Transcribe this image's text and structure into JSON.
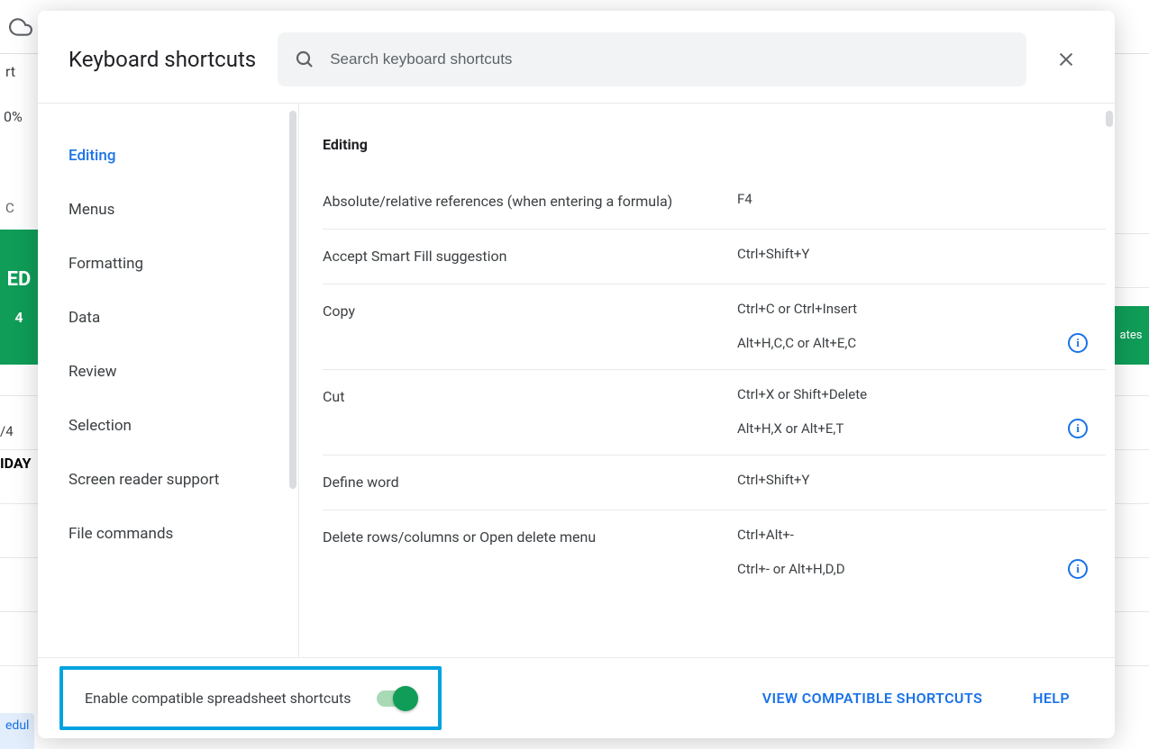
{
  "bg": {
    "rt": "rt",
    "percent": "0%",
    "cellC": "C",
    "green1a": "ED",
    "green1b": "4",
    "green2": "ates",
    "cell1": "/4",
    "cell2": "IDAY",
    "tab": "edul"
  },
  "dialog": {
    "title": "Keyboard shortcuts",
    "search_placeholder": "Search keyboard shortcuts",
    "sidebar": [
      "Editing",
      "Menus",
      "Formatting",
      "Data",
      "Review",
      "Selection",
      "Screen reader support",
      "File commands"
    ],
    "section_title": "Editing",
    "shortcuts": [
      {
        "name": "Absolute/relative references (when entering a formula)",
        "keys": [
          "F4"
        ],
        "info": false
      },
      {
        "name": "Accept Smart Fill suggestion",
        "keys": [
          "Ctrl+Shift+Y"
        ],
        "info": false
      },
      {
        "name": "Copy",
        "keys": [
          "Ctrl+C or Ctrl+Insert",
          "Alt+H,C,C or Alt+E,C"
        ],
        "info": true
      },
      {
        "name": "Cut",
        "keys": [
          "Ctrl+X or Shift+Delete",
          "Alt+H,X or Alt+E,T"
        ],
        "info": true
      },
      {
        "name": "Define word",
        "keys": [
          "Ctrl+Shift+Y"
        ],
        "info": false
      },
      {
        "name": "Delete rows/columns or Open delete menu",
        "keys": [
          "Ctrl+Alt+-",
          "Ctrl+- or Alt+H,D,D"
        ],
        "info": true
      }
    ],
    "footer": {
      "compat_label": "Enable compatible spreadsheet shortcuts",
      "view_compat": "VIEW COMPATIBLE SHORTCUTS",
      "help": "HELP"
    }
  }
}
